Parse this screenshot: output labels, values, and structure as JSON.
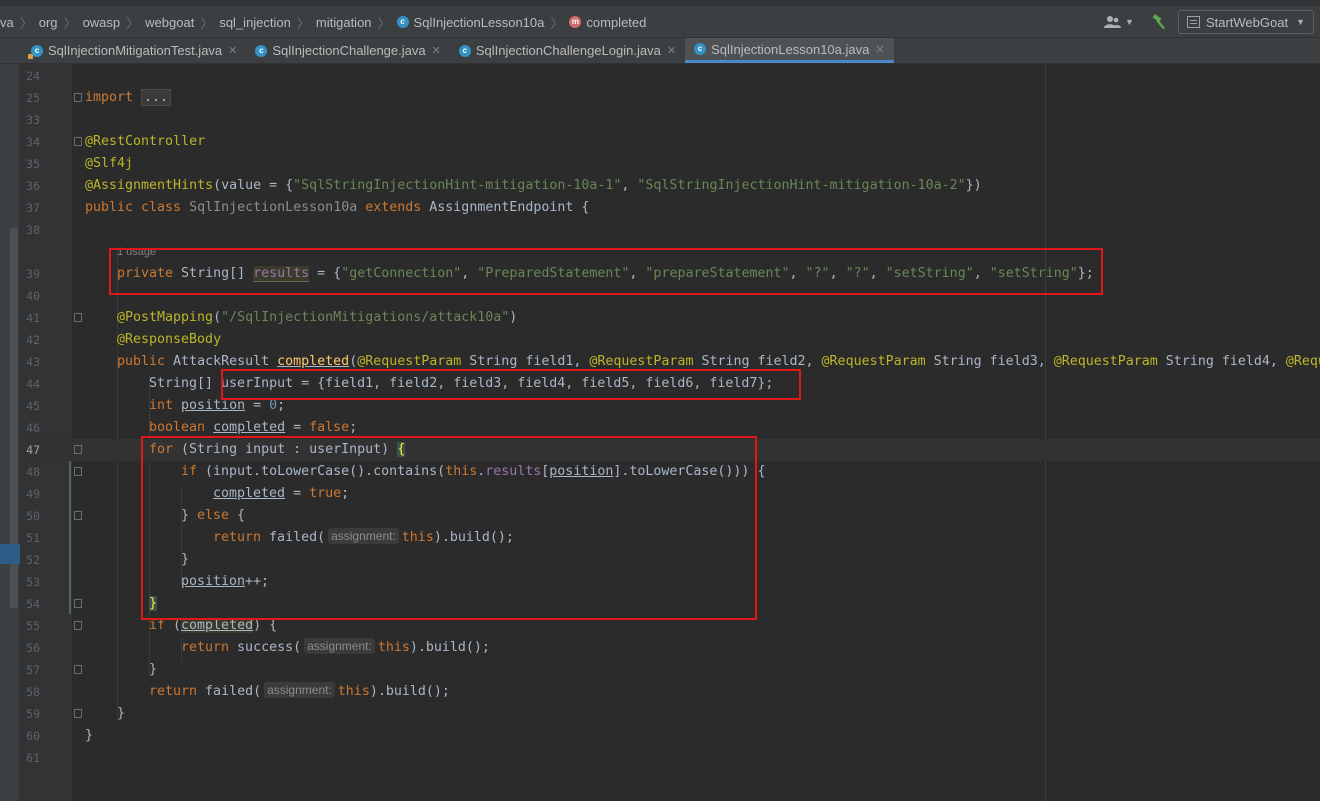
{
  "breadcrumb": {
    "items": [
      "va",
      "org",
      "owasp",
      "webgoat",
      "sql_injection",
      "mitigation",
      "SqlInjectionLesson10a",
      "completed"
    ]
  },
  "toolbar": {
    "run_config": "StartWebGoat"
  },
  "tabs": [
    {
      "label": "SqlInjectionMitigationTest.java",
      "active": false
    },
    {
      "label": "SqlInjectionChallenge.java",
      "active": false
    },
    {
      "label": "SqlInjectionChallengeLogin.java",
      "active": false
    },
    {
      "label": "SqlInjectionLesson10a.java",
      "active": true
    }
  ],
  "editor": {
    "usage_hint": "1 usage",
    "inlay_hint": "assignment:",
    "line_numbers": {
      "l24": "24",
      "l25": "25",
      "l33": "33",
      "l34": "34",
      "l35": "35",
      "l36": "36",
      "l37": "37",
      "l38": "38",
      "l39": "39",
      "l40": "40",
      "l41": "41",
      "l42": "42",
      "l43": "43",
      "l44": "44",
      "l45": "45",
      "l46": "46",
      "l47": "47",
      "l48": "48",
      "l49": "49",
      "l50": "50",
      "l51": "51",
      "l52": "52",
      "l53": "53",
      "l54": "54",
      "l55": "55",
      "l56": "56",
      "l57": "57",
      "l58": "58",
      "l59": "59",
      "l60": "60",
      "l61": "61"
    },
    "current_line": "47"
  },
  "colors": {
    "keyword": "#cc7832",
    "string": "#6a8759",
    "annotation": "#bbb529",
    "number": "#6897bb",
    "field": "#9876aa",
    "highlight_box": "#e01818",
    "active_tab_underline": "#4a88c7"
  },
  "icons": [
    "class-icon",
    "method-icon",
    "user-icon",
    "hammer-icon",
    "run-config-icon",
    "fold-icon"
  ]
}
